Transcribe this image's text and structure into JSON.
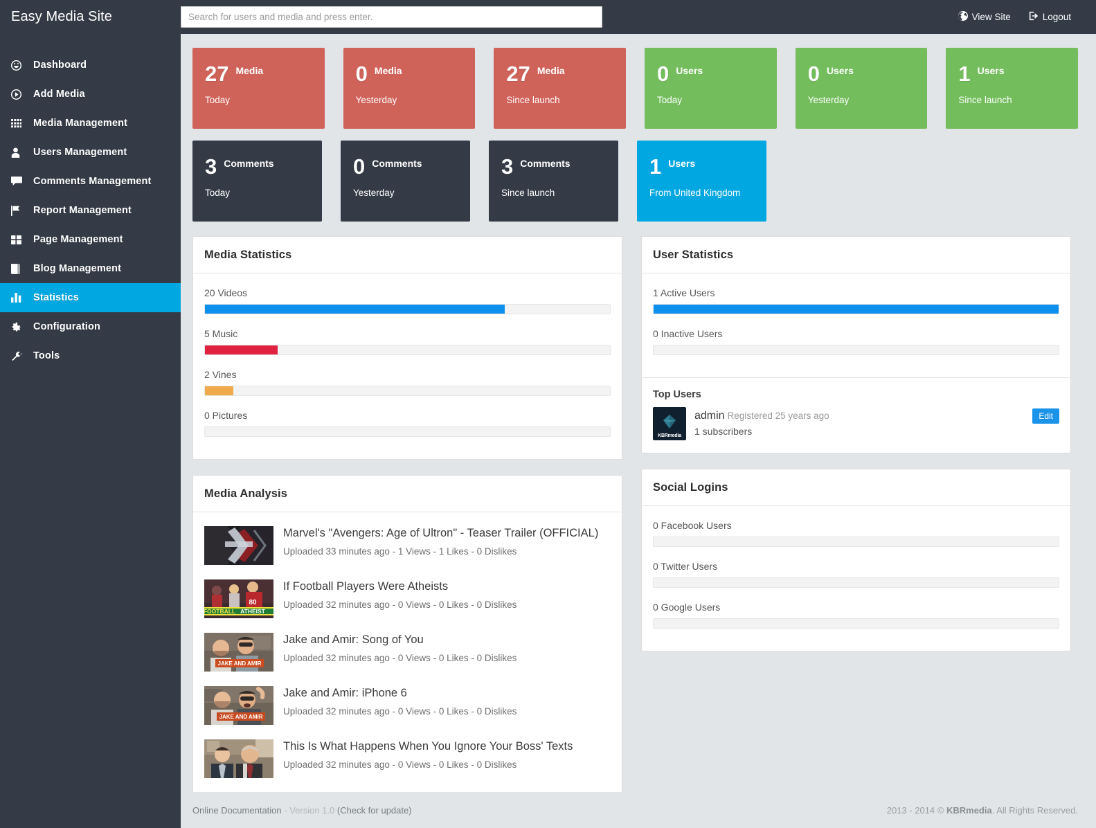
{
  "brand": {
    "title": "Easy Media Site"
  },
  "search": {
    "placeholder": "Search for users and media and press enter.",
    "value": ""
  },
  "topbar": {
    "view_site": "View Site",
    "logout": "Logout"
  },
  "sidebar": {
    "items": [
      {
        "label": "Dashboard",
        "icon": "dashboard-icon",
        "active": false
      },
      {
        "label": "Add Media",
        "icon": "add-media-icon",
        "active": false
      },
      {
        "label": "Media Management",
        "icon": "grid-icon",
        "active": false
      },
      {
        "label": "Users Management",
        "icon": "user-icon",
        "active": false
      },
      {
        "label": "Comments Management",
        "icon": "comment-icon",
        "active": false
      },
      {
        "label": "Report Management",
        "icon": "flag-icon",
        "active": false
      },
      {
        "label": "Page Management",
        "icon": "pages-icon",
        "active": false
      },
      {
        "label": "Blog Management",
        "icon": "book-icon",
        "active": false
      },
      {
        "label": "Statistics",
        "icon": "chart-icon",
        "active": true
      },
      {
        "label": "Configuration",
        "icon": "gear-icon",
        "active": false
      },
      {
        "label": "Tools",
        "icon": "wrench-icon",
        "active": false
      }
    ]
  },
  "cards_row1": [
    {
      "value": "27",
      "unit": "Media",
      "sub": "Today",
      "color": "#cf6259"
    },
    {
      "value": "0",
      "unit": "Media",
      "sub": "Yesterday",
      "color": "#cf6259"
    },
    {
      "value": "27",
      "unit": "Media",
      "sub": "Since launch",
      "color": "#cf6259"
    },
    {
      "value": "0",
      "unit": "Users",
      "sub": "Today",
      "color": "#74bd5d"
    },
    {
      "value": "0",
      "unit": "Users",
      "sub": "Yesterday",
      "color": "#74bd5d"
    },
    {
      "value": "1",
      "unit": "Users",
      "sub": "Since launch",
      "color": "#74bd5d"
    }
  ],
  "cards_row2": [
    {
      "value": "3",
      "unit": "Comments",
      "sub": "Today",
      "color": "#343a46"
    },
    {
      "value": "0",
      "unit": "Comments",
      "sub": "Yesterday",
      "color": "#343a46"
    },
    {
      "value": "3",
      "unit": "Comments",
      "sub": "Since launch",
      "color": "#343a46"
    },
    {
      "value": "1",
      "unit": "Users",
      "sub": "From United Kingdom",
      "color": "#00a7e1"
    }
  ],
  "media_statistics": {
    "title": "Media Statistics",
    "bars": [
      {
        "label": "20 Videos",
        "percent": 74,
        "color": "#0e90ee"
      },
      {
        "label": "5 Music",
        "percent": 18,
        "color": "#e0213f"
      },
      {
        "label": "2 Vines",
        "percent": 7,
        "color": "#eeaa4b"
      },
      {
        "label": "0 Pictures",
        "percent": 0,
        "color": "#f3f3f3"
      }
    ]
  },
  "user_statistics": {
    "title": "User Statistics",
    "bars": [
      {
        "label": "1 Active Users",
        "percent": 100,
        "color": "#0e90ee"
      },
      {
        "label": "0 Inactive Users",
        "percent": 0,
        "color": "#f3f3f3"
      }
    ],
    "top_users_heading": "Top Users",
    "top_users": [
      {
        "name": "admin",
        "registered": "Registered 25 years ago",
        "subscribers": "1 subscribers",
        "avatar_label": "KBRmedia",
        "edit_label": "Edit"
      }
    ]
  },
  "social_logins": {
    "title": "Social Logins",
    "bars": [
      {
        "label": "0 Facebook Users",
        "percent": 0,
        "color": "#f3f3f3"
      },
      {
        "label": "0 Twitter Users",
        "percent": 0,
        "color": "#f3f3f3"
      },
      {
        "label": "0 Google Users",
        "percent": 0,
        "color": "#f3f3f3"
      }
    ]
  },
  "media_analysis": {
    "title": "Media Analysis",
    "items": [
      {
        "title": "Marvel's \"Avengers: Age of Ultron\" - Teaser Trailer (OFFICIAL)",
        "meta": "Uploaded 33 minutes ago - 1 Views - 1 Likes - 0 Dislikes",
        "thumb": "avengers"
      },
      {
        "title": "If Football Players Were Atheists",
        "meta": "Uploaded 32 minutes ago - 0 Views - 0 Likes - 0 Dislikes",
        "thumb": "football"
      },
      {
        "title": "Jake and Amir: Song of You",
        "meta": "Uploaded 32 minutes ago - 0 Views - 0 Likes - 0 Dislikes",
        "thumb": "jakeamir1"
      },
      {
        "title": "Jake and Amir: iPhone 6",
        "meta": "Uploaded 32 minutes ago - 0 Views - 0 Likes - 0 Dislikes",
        "thumb": "jakeamir2"
      },
      {
        "title": "This Is What Happens When You Ignore Your Boss' Texts",
        "meta": "Uploaded 32 minutes ago - 0 Views - 0 Likes - 0 Dislikes",
        "thumb": "boss"
      }
    ]
  },
  "footer": {
    "doc_link": "Online Documentation",
    "version": "- Version 1.0",
    "update_link": "(Check for update)",
    "copyright_prefix": "2013 - 2014 © ",
    "copyright_brand": "KBRmedia",
    "copyright_suffix": ". All Rights Reserved."
  }
}
